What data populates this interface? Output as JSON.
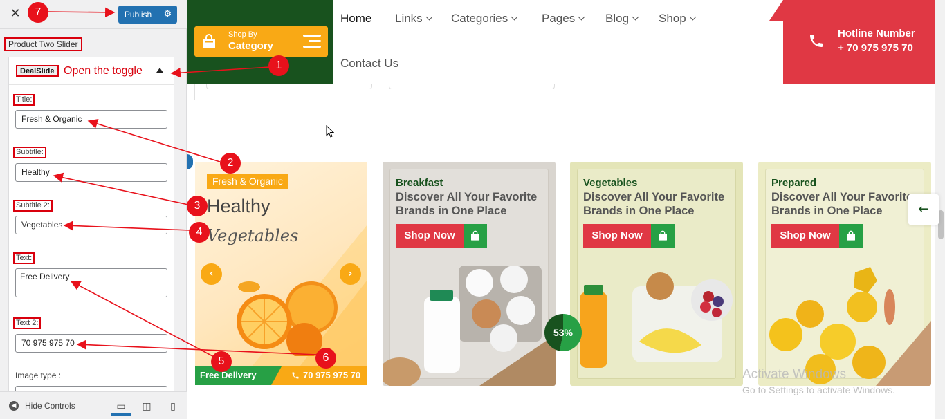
{
  "customizer": {
    "publish_label": "Publish",
    "section_title": "Product Two Slider",
    "panel": {
      "tag": "DealSlide",
      "toggle_note": "Open the toggle",
      "fields": {
        "title_label": "Title:",
        "title_value": "Fresh & Organic",
        "subtitle_label": "Subtitle:",
        "subtitle_value": "Healthy",
        "subtitle2_label": "Subtitle 2:",
        "subtitle2_value": "Vegetables",
        "text_label": "Text:",
        "text_value": "Free Delivery",
        "text2_label": "Text 2:",
        "text2_value": "70 975 975 70",
        "image_type_label": "Image type :"
      }
    },
    "footer": {
      "hide_controls": "Hide Controls"
    }
  },
  "site": {
    "category_button": {
      "small": "Shop By",
      "big": "Category"
    },
    "nav": {
      "home": "Home",
      "links": "Links",
      "categories": "Categories",
      "pages": "Pages",
      "blog": "Blog",
      "shop": "Shop",
      "contact": "Contact Us"
    },
    "hotline": {
      "title": "Hotline Number",
      "number": "+ 70 975 975 70"
    },
    "slider": {
      "tag": "Fresh & Organic",
      "subtitle": "Healthy",
      "subtitle2": "Vegetables",
      "text": "Free Delivery",
      "text2": "70 975 975 70"
    },
    "cards": [
      {
        "category": "Breakfast",
        "title_line1": "Discover All Your Favorite",
        "title_line2": "Brands in One Place",
        "button": "Shop Now"
      },
      {
        "category": "Vegetables",
        "title_line1": "Discover All Your Favorite",
        "title_line2": "Brands in One Place",
        "button": "Shop Now"
      },
      {
        "category": "Prepared",
        "title_line1": "Discover All Your Favorite",
        "title_line2": "Brands in One Place",
        "button": "Shop Now"
      }
    ],
    "discount": "53%",
    "watermark": {
      "line1": "Activate Windows",
      "line2": "Go to Settings to activate Windows."
    }
  },
  "annotations": [
    "1",
    "2",
    "3",
    "4",
    "5",
    "6",
    "7"
  ],
  "colors": {
    "brand_green": "#18521e",
    "accent_orange": "#f9a915",
    "accent_red": "#e03844",
    "button_green": "#27a045",
    "wp_blue": "#2271b1",
    "annotation_red": "#e8111b"
  }
}
